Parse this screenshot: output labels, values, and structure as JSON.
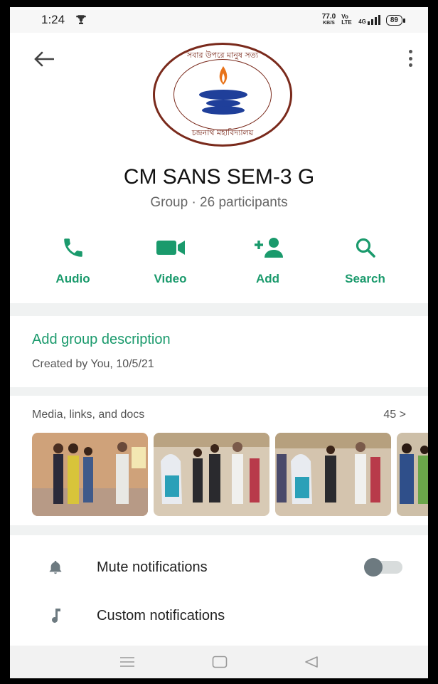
{
  "status": {
    "time": "1:24",
    "speed": "77.0",
    "speed_unit": "KB/S",
    "volte": "Vo LTE",
    "network": "4G",
    "battery": "89"
  },
  "group": {
    "name": "CM SANS SEM-3 G",
    "subtitle": "Group · 26 participants",
    "logo_top_text": "সবার উপরে মানুষ সত্য",
    "logo_bottom_text": "চন্দ্রনাথ মহাবিদ্যালয়"
  },
  "actions": [
    {
      "label": "Audio",
      "icon": "phone-icon"
    },
    {
      "label": "Video",
      "icon": "video-icon"
    },
    {
      "label": "Add",
      "icon": "add-person-icon"
    },
    {
      "label": "Search",
      "icon": "search-icon"
    }
  ],
  "description": {
    "title": "Add group description",
    "created": "Created by You, 10/5/21"
  },
  "media": {
    "title": "Media, links, and docs",
    "count": "45 >"
  },
  "settings": {
    "mute": {
      "label": "Mute notifications",
      "enabled": false
    },
    "custom": {
      "label": "Custom notifications"
    }
  },
  "colors": {
    "accent": "#1a9a6c",
    "background": "#ffffff",
    "section_gap": "#f0f2f2"
  }
}
